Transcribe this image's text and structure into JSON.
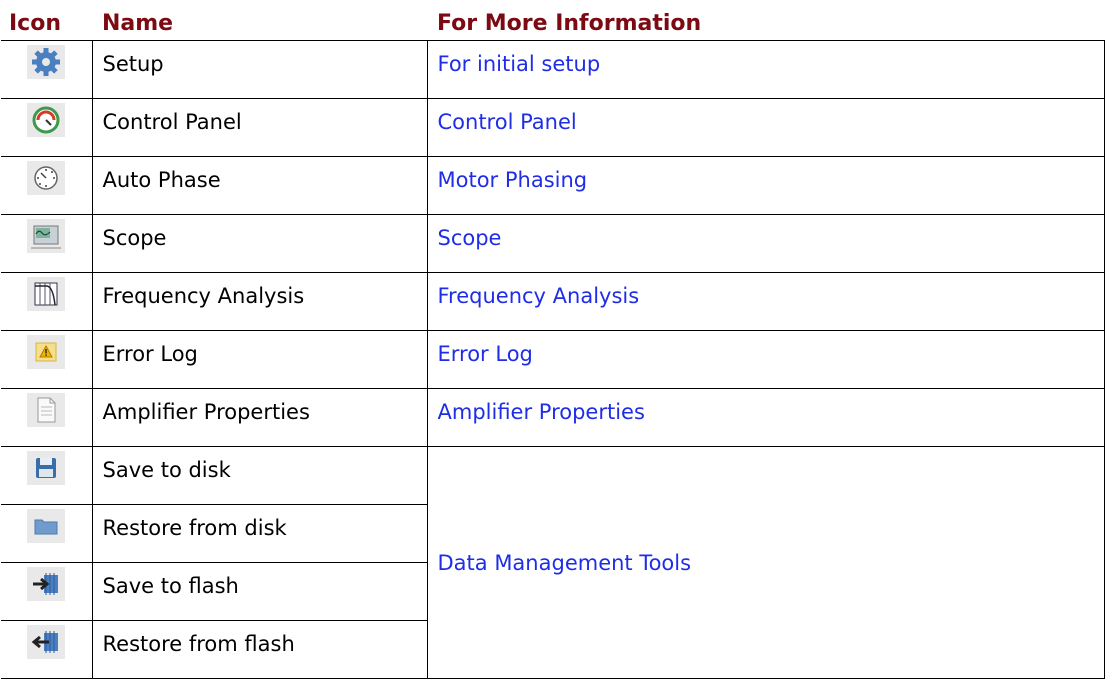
{
  "headers": {
    "icon": "Icon",
    "name": "Name",
    "info": "For More Information"
  },
  "rows": [
    {
      "icon": "gear-icon",
      "name": "Setup",
      "info": "For initial setup"
    },
    {
      "icon": "gauge-icon",
      "name": "Control Panel",
      "info": "Control Panel"
    },
    {
      "icon": "dial-icon",
      "name": "Auto Phase",
      "info": "Motor Phasing"
    },
    {
      "icon": "oscilloscope-icon",
      "name": "Scope",
      "info": "Scope"
    },
    {
      "icon": "frequency-plot-icon",
      "name": "Frequency Analysis",
      "info": "Frequency Analysis"
    },
    {
      "icon": "warning-icon",
      "name": "Error Log",
      "info": "Error Log"
    },
    {
      "icon": "document-icon",
      "name": "Amplifier Properties",
      "info": "Amplifier Properties"
    },
    {
      "icon": "floppy-disk-icon",
      "name": "Save to disk"
    },
    {
      "icon": "folder-icon",
      "name": "Restore from disk"
    },
    {
      "icon": "chip-arrow-in-icon",
      "name": "Save to flash"
    },
    {
      "icon": "chip-arrow-out-icon",
      "name": "Restore from flash"
    }
  ],
  "merged_info": "Data Management Tools",
  "colors": {
    "header_text": "#7b0a12",
    "link_text": "#1f2de6"
  }
}
